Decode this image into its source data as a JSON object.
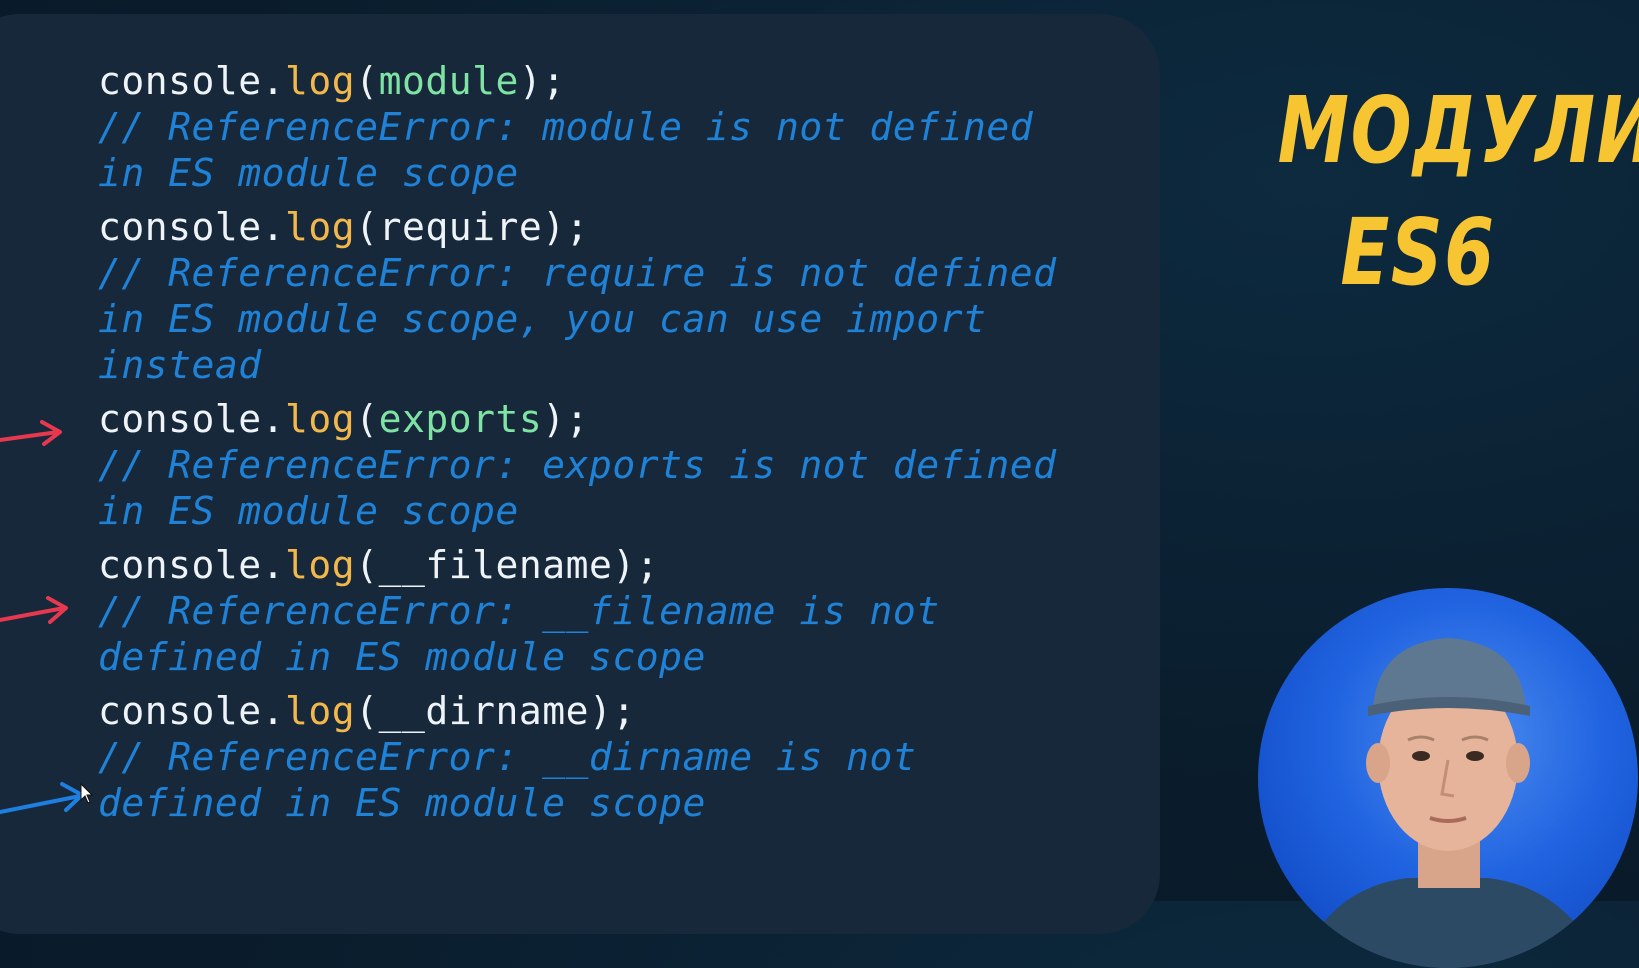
{
  "title": {
    "line1": "МОДУЛИ",
    "line2": "ES6"
  },
  "code": {
    "blocks": [
      {
        "prefix": "console.",
        "fn": "log",
        "open": "(",
        "arg": "module",
        "close": ");",
        "comment": [
          "// ReferenceError: module is not defined",
          "in ES module scope"
        ]
      },
      {
        "prefix": "console.",
        "fn": "log",
        "open": "(",
        "arg": "require",
        "close": ");",
        "comment": [
          "// ReferenceError: require is not defined",
          "in ES module scope, you can use import",
          "instead"
        ]
      },
      {
        "prefix": "console.",
        "fn": "log",
        "open": "(",
        "arg": "exports",
        "close": ");",
        "comment": [
          "// ReferenceError: exports is not defined",
          "in ES module scope"
        ]
      },
      {
        "prefix": "console.",
        "fn": "log",
        "open": "(",
        "arg": "__filename",
        "close": ");",
        "comment": [
          "// ReferenceError: __filename is not",
          "defined in ES module scope"
        ]
      },
      {
        "prefix": "console.",
        "fn": "log",
        "open": "(",
        "arg": "__dirname",
        "close": ");",
        "comment": [
          "// ReferenceError: __dirname is not",
          "defined in ES module scope"
        ]
      }
    ]
  },
  "colors": {
    "title": "#f7c531",
    "comment": "#1f82d6",
    "function": "#f2b84b",
    "argument_green": "#7fe3a4",
    "plain": "#eef3f7",
    "arrow_red": "#e8384f",
    "arrow_blue": "#1f7fe0"
  },
  "icons": [
    "arrow-red-icon",
    "arrow-blue-icon",
    "mouse-cursor-icon",
    "presenter-avatar"
  ]
}
